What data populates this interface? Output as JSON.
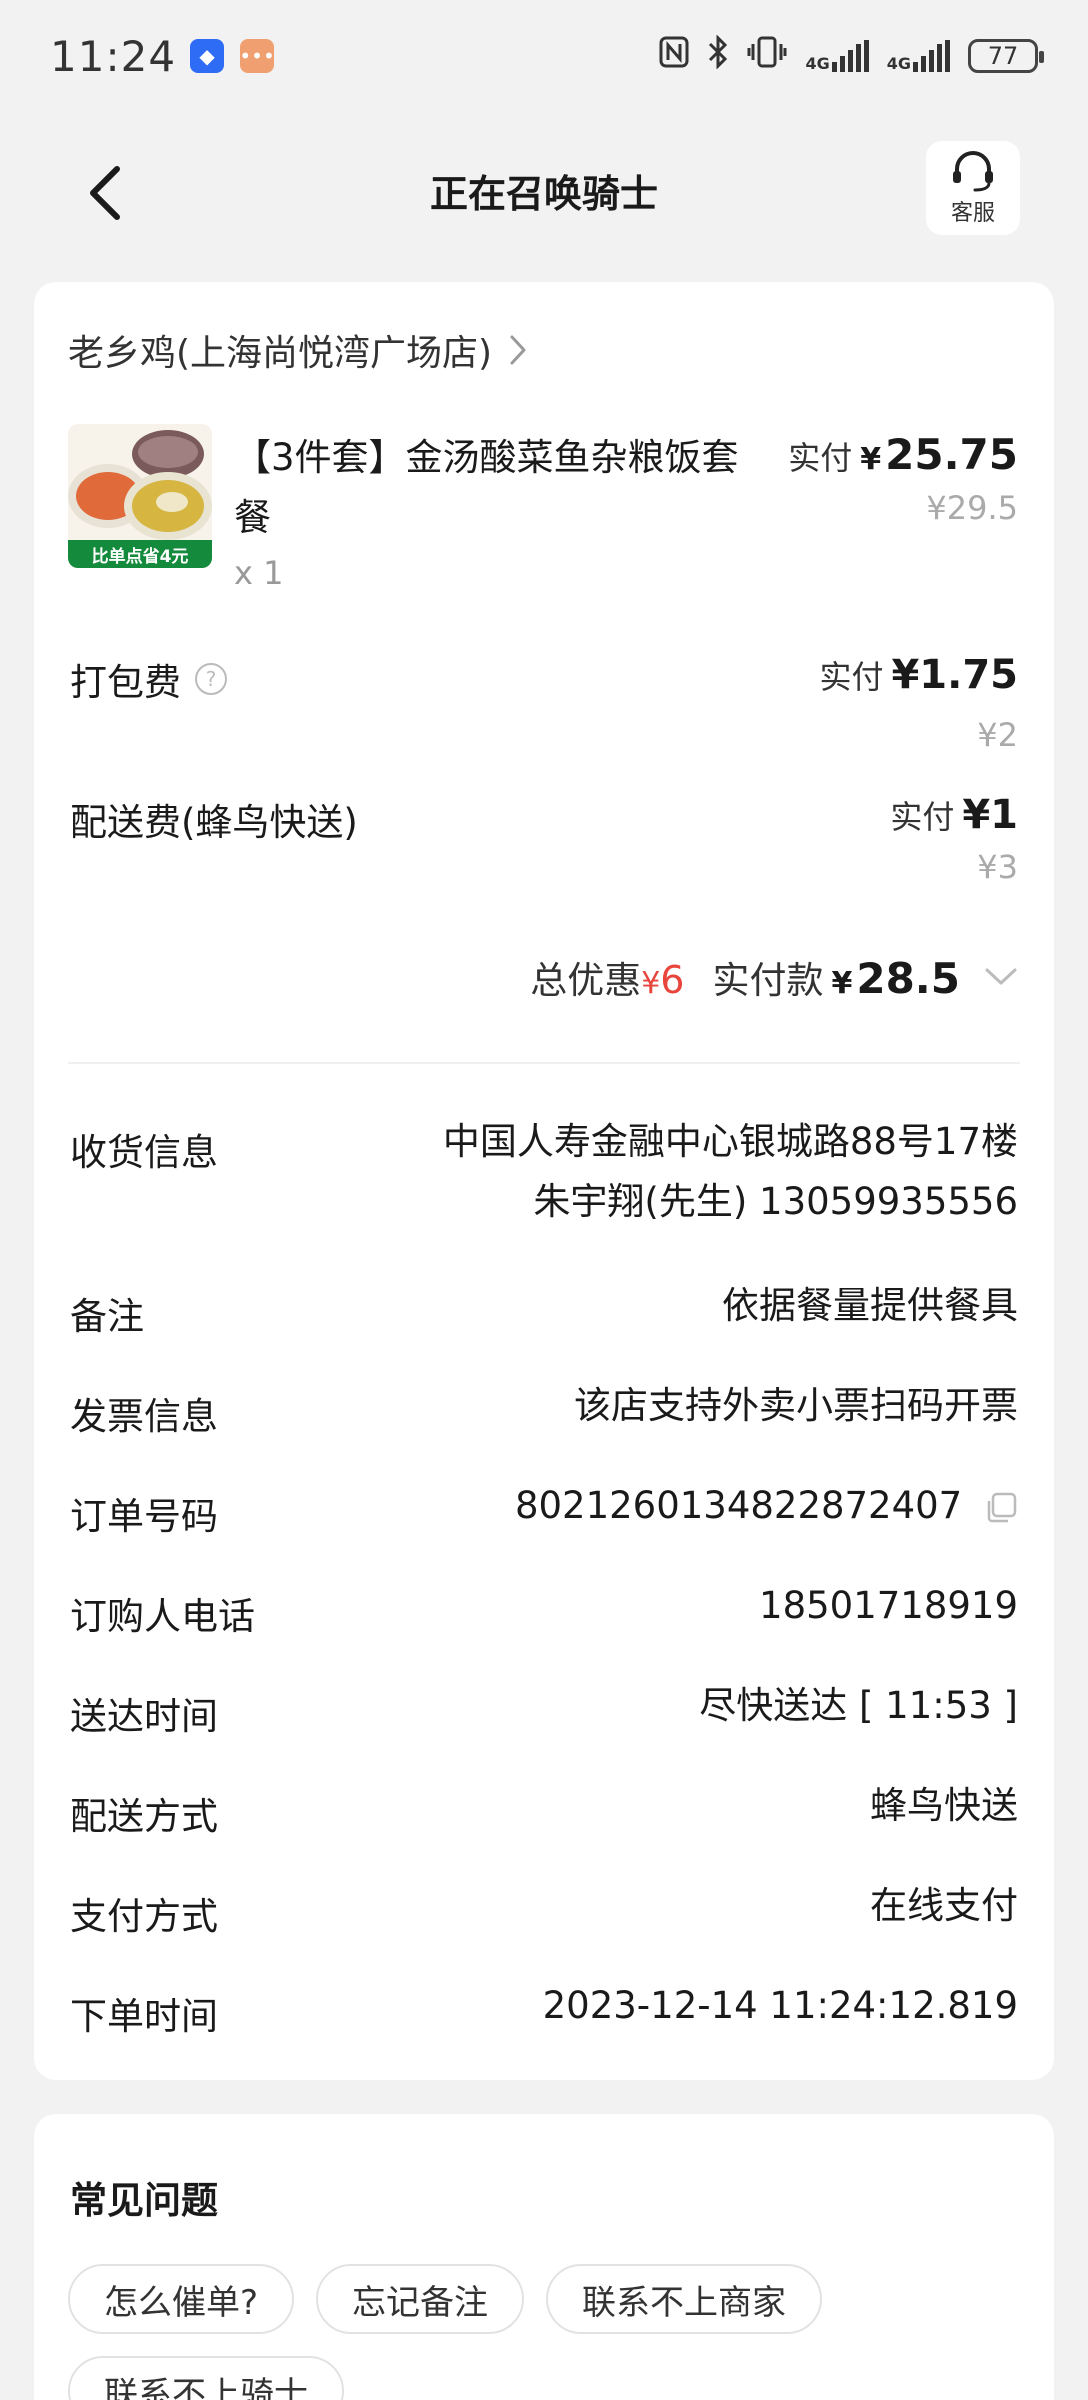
{
  "status_bar": {
    "time": "11:24",
    "battery": "77",
    "network_1": "4G",
    "network_2": "4G",
    "icons": [
      "nfc-icon",
      "bluetooth-icon",
      "vibrate-icon",
      "signal-icon",
      "signal-icon",
      "battery-icon"
    ]
  },
  "nav": {
    "title": "正在召唤骑士",
    "service_label": "客服"
  },
  "order": {
    "store_name": "老乡鸡(上海尚悦湾广场店)",
    "product": {
      "name": "【3件套】金汤酸菜鱼杂粮饭套餐",
      "qty": "x 1",
      "badge": "比单点省4元",
      "paid_label": "实付",
      "yen": "¥",
      "paid_amount": "25.75",
      "original_price": "¥29.5"
    },
    "packing_fee": {
      "label": "打包费",
      "paid_label": "实付",
      "paid_amount": "¥1.75",
      "original_price": "¥2"
    },
    "delivery_fee": {
      "label": "配送费(蜂鸟快送)",
      "paid_label": "实付",
      "paid_amount": "¥1",
      "original_price": "¥3"
    },
    "total": {
      "discount_label": "总优惠",
      "discount_yen": "¥",
      "discount_value": "6",
      "total_label": "实付款",
      "yen": "¥",
      "total_amount": "28.5"
    },
    "info": {
      "address_label": "收货信息",
      "address_line1": "中国人寿金融中心银城路88号17楼",
      "address_line2": "朱宇翔(先生) 13059935556",
      "remark_label": "备注",
      "remark_value": "依据餐量提供餐具",
      "invoice_label": "发票信息",
      "invoice_value": "该店支持外卖小票扫码开票",
      "order_no_label": "订单号码",
      "order_no_value": "8021260134822872407",
      "buyer_phone_label": "订购人电话",
      "buyer_phone_value": "18501718919",
      "delivery_time_label": "送达时间",
      "delivery_time_value": "尽快送达 [ 11:53 ]",
      "delivery_method_label": "配送方式",
      "delivery_method_value": "蜂鸟快送",
      "payment_method_label": "支付方式",
      "payment_method_value": "在线支付",
      "order_time_label": "下单时间",
      "order_time_value": "2023-12-14 11:24:12.819"
    }
  },
  "faq": {
    "title": "常见问题",
    "chips": [
      "怎么催单?",
      "忘记备注",
      "联系不上商家",
      "联系不上骑士"
    ]
  }
}
